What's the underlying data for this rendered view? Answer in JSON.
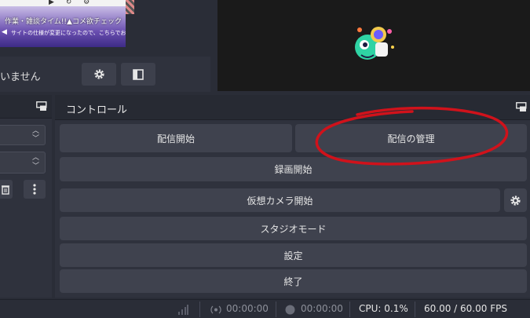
{
  "scene_thumbnail": {
    "controls_glyphs": "▶ ↻ ⚙",
    "headline": "作業・雑談タイム!!▲コメ欲チェック",
    "subline": "サイトの仕様が変更になったので、こちらでお知らせします"
  },
  "scene_bar": {
    "message": "いません"
  },
  "controls_dock": {
    "title": "コントロール",
    "buttons": {
      "start_streaming": "配信開始",
      "manage_broadcast": "配信の管理",
      "start_recording": "録画開始",
      "start_virtual_camera": "仮想カメラ開始",
      "studio_mode": "スタジオモード",
      "settings": "設定",
      "exit": "終了"
    }
  },
  "status_bar": {
    "stream_time": "00:00:00",
    "record_time": "00:00:00",
    "cpu": "CPU: 0.1%",
    "fps": "60.00 / 60.00 FPS"
  },
  "colors": {
    "panel": "#2f323d",
    "button": "#3f424e",
    "preview": "#1a1a1a",
    "annotation": "#d0121b"
  }
}
